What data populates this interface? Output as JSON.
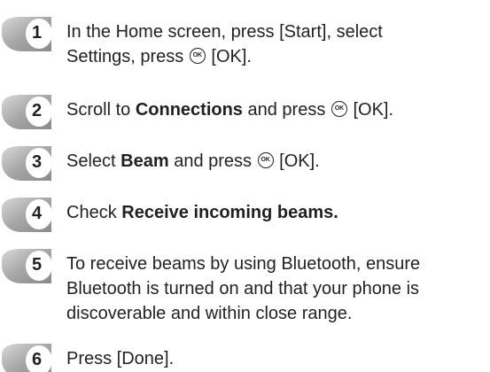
{
  "ok_icon_label": "OK",
  "steps": [
    {
      "number": "1",
      "line1": "In the Home screen, press [Start], select",
      "line2_pre": "Settings, press",
      "line2_post": "[OK]."
    },
    {
      "number": "2",
      "pre": "Scroll to",
      "bold": "Connections",
      "mid": "and press",
      "post": "[OK]."
    },
    {
      "number": "3",
      "pre": "Select",
      "bold": "Beam",
      "mid": "and press",
      "post": "[OK]."
    },
    {
      "number": "4",
      "pre": "Check",
      "bold": "Receive incoming beams."
    },
    {
      "number": "5",
      "line1": "To receive beams by using Bluetooth, ensure",
      "line2": "Bluetooth is turned on and that your phone is",
      "line3": "discoverable and within close range."
    },
    {
      "number": "6",
      "text": "Press [Done]."
    }
  ]
}
